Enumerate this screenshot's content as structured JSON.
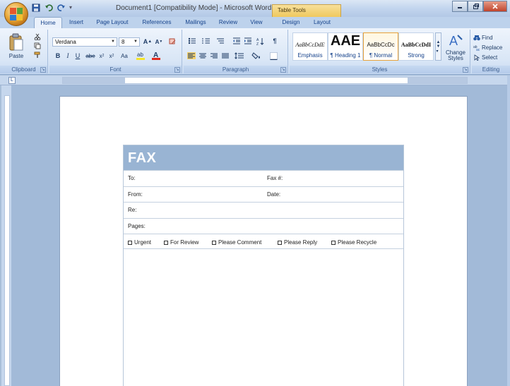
{
  "window": {
    "title": "Document1 [Compatibility Mode] - Microsoft Word",
    "contextual_tab_group": "Table Tools"
  },
  "tabs": [
    "Home",
    "Insert",
    "Page Layout",
    "References",
    "Mailings",
    "Review",
    "View",
    "Design",
    "Layout"
  ],
  "ribbon": {
    "clipboard": {
      "paste_label": "Paste",
      "group_label": "Clipboard"
    },
    "font": {
      "font_name": "Verdana",
      "font_size": "8",
      "group_label": "Font"
    },
    "paragraph": {
      "group_label": "Paragraph"
    },
    "styles": {
      "group_label": "Styles",
      "tiles": [
        {
          "sample": "AaBbCcDdE",
          "name": "Emphasis"
        },
        {
          "sample": "AAE",
          "name": "¶ Heading 1"
        },
        {
          "sample": "AaBbCcDc",
          "name": "¶ Normal"
        },
        {
          "sample": "AaBbCcDdI",
          "name": "Strong"
        }
      ],
      "change_styles": "Change Styles"
    },
    "editing": {
      "group_label": "Editing",
      "find": "Find",
      "replace": "Replace",
      "select": "Select"
    }
  },
  "fax": {
    "title": "FAX",
    "to_label": "To:",
    "fax_no_label": "Fax #:",
    "from_label": "From:",
    "date_label": "Date:",
    "re_label": "Re:",
    "pages_label": "Pages:",
    "checks": [
      "Urgent",
      "For Review",
      "Please Comment",
      "Please Reply",
      "Please Recycle"
    ]
  },
  "colors": {
    "fax_header": "#99b4d3",
    "ribbon_bg": "#d9e6f6",
    "workspace": "#a2bad8",
    "table_tools": "#efc75a"
  },
  "icons": [
    "office-button",
    "save-icon",
    "undo-icon",
    "redo-icon",
    "paste-icon",
    "cut-icon",
    "copy-icon",
    "format-painter-icon",
    "binoculars-icon"
  ]
}
